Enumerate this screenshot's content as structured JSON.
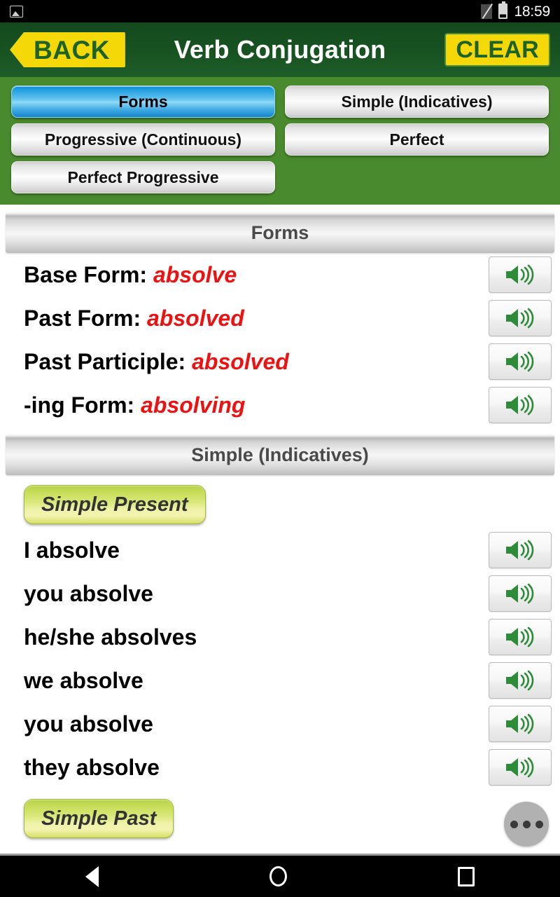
{
  "statusbar": {
    "image_icon": "image-icon",
    "nosim_icon": "no-sim-icon",
    "battery_icon": "battery-icon",
    "time": "18:59"
  },
  "appbar": {
    "back_label": "BACK",
    "title": "Verb Conjugation",
    "clear_label": "CLEAR",
    "bg_color": "#185322"
  },
  "tabs": [
    {
      "label": "Forms",
      "active": true
    },
    {
      "label": "Simple (Indicatives)",
      "active": false
    },
    {
      "label": "Progressive (Continuous)",
      "active": false
    },
    {
      "label": "Perfect",
      "active": false
    },
    {
      "label": "Perfect Progressive",
      "active": false
    }
  ],
  "forms_section": {
    "header": "Forms",
    "rows": [
      {
        "label": "Base Form:",
        "value": "absolve",
        "speaker": "speaker-icon"
      },
      {
        "label": "Past Form:",
        "value": "absolved",
        "speaker": "speaker-icon"
      },
      {
        "label": "Past Participle:",
        "value": "absolved",
        "speaker": "speaker-icon"
      },
      {
        "label": "-ing Form:",
        "value": "absolving",
        "speaker": "speaker-icon"
      }
    ]
  },
  "simple_section": {
    "header": "Simple (Indicatives)",
    "tense_present": "Simple Present",
    "present_rows": [
      "I absolve",
      "you absolve",
      "he/she absolves",
      "we absolve",
      "you absolve",
      "they absolve"
    ],
    "tense_past": "Simple Past"
  },
  "overflow": {
    "label": "overflow-menu"
  },
  "navbar": {
    "back": "nav-back-icon",
    "home": "nav-home-icon",
    "recent": "nav-recent-icon"
  },
  "colors": {
    "header_green": "#185322",
    "band_green": "#4a8a2e",
    "accent_yellow": "#f5d808",
    "value_red": "#ee1111",
    "active_blue": "#63c4ef",
    "badge_green": "#cbdf5e",
    "speaker_green": "#2e8b3a"
  }
}
